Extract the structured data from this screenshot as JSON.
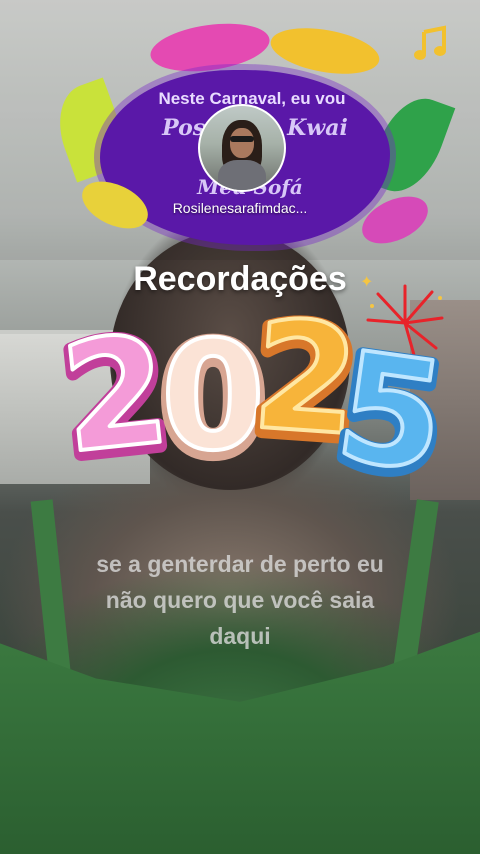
{
  "banner": {
    "line1": "Neste Carnaval, eu vou",
    "line2": "Postar no Kwai",
    "line3": "Meu Sofá"
  },
  "profile": {
    "username": "Rosilenesarafimdac..."
  },
  "memories": {
    "title": "Recordações",
    "year": [
      "2",
      "0",
      "2",
      "5"
    ]
  },
  "lyrics": {
    "lines": [
      "se a genterdar de perto eu",
      "não quero que você saia",
      "daqui"
    ]
  },
  "colors": {
    "digit1": "#f49bd8",
    "digit2": "#fbe3d6",
    "digit3": "#f7b43a",
    "digit4": "#59b5ef",
    "banner": "#5a18a8"
  },
  "icons": {
    "music": "music-note-icon",
    "firework": "firework-icon",
    "sparkle": "sparkle-icon"
  }
}
